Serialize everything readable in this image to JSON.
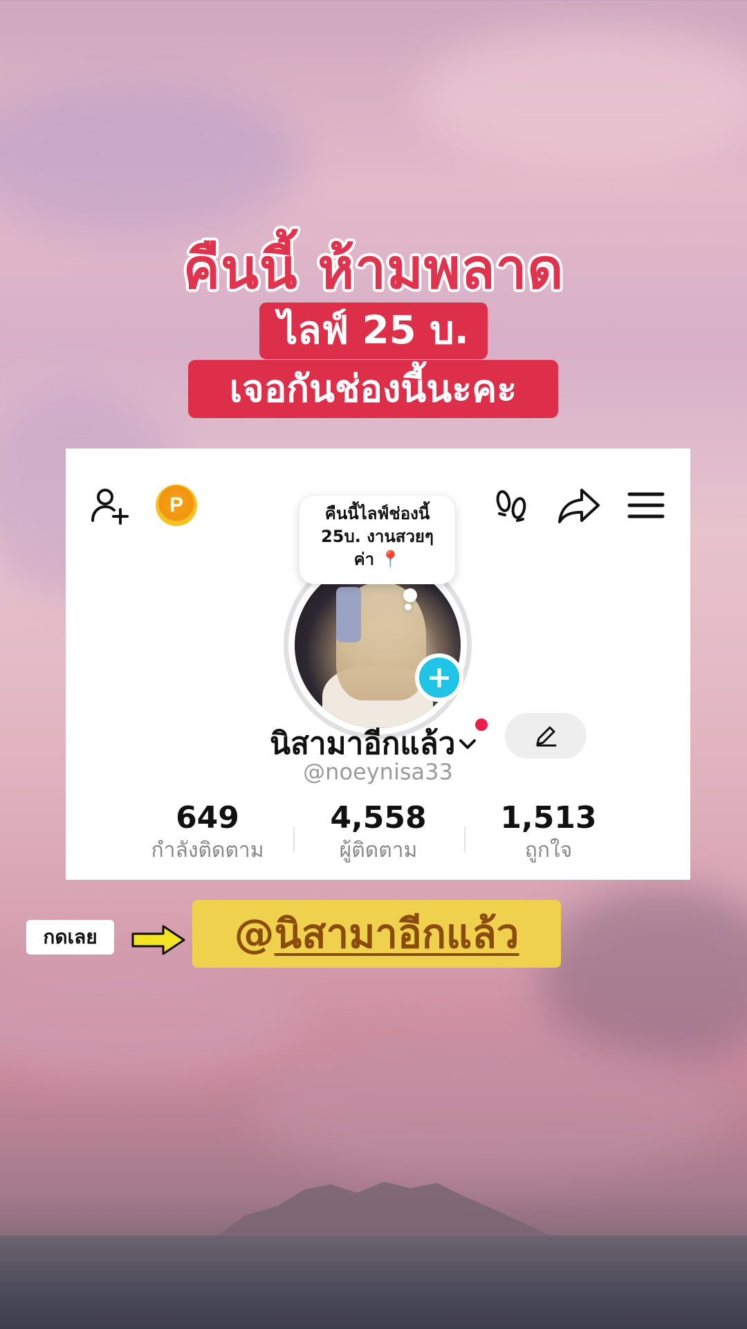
{
  "headline": "คืนนี้ ห้ามพลาด",
  "tag_line_1": "ไลฟ์ 25 บ.",
  "tag_line_2": "เจอกันช่องนี้นะคะ",
  "profile": {
    "bubble_lines": [
      "คืนนี้ไลฟ์ช่องนี้",
      "25บ. งานสวยๆ",
      "ค่า 📍"
    ],
    "display_name": "นิสามาอีกแล้ว",
    "handle": "@noeynisa33",
    "points_letter": "P",
    "stats": [
      {
        "value": "649",
        "label": "กำลังติดตาม"
      },
      {
        "value": "4,558",
        "label": "ผู้ติดตาม"
      },
      {
        "value": "1,513",
        "label": "ถูกใจ"
      }
    ]
  },
  "cta": {
    "press_label": "กดเลย",
    "at": "@",
    "name": "นิสามาอีกแล้ว"
  },
  "colors": {
    "accent_red": "#dd2f4a",
    "cta_yellow": "#f0d14d",
    "plus_cyan": "#20c4e6",
    "dot_red": "#ec1e4c"
  },
  "icons": [
    "add-user-icon",
    "points-icon",
    "footprint-icon",
    "share-icon",
    "menu-icon",
    "plus-icon",
    "chevron-down-icon",
    "edit-pencil-icon",
    "arrow-right-icon"
  ]
}
